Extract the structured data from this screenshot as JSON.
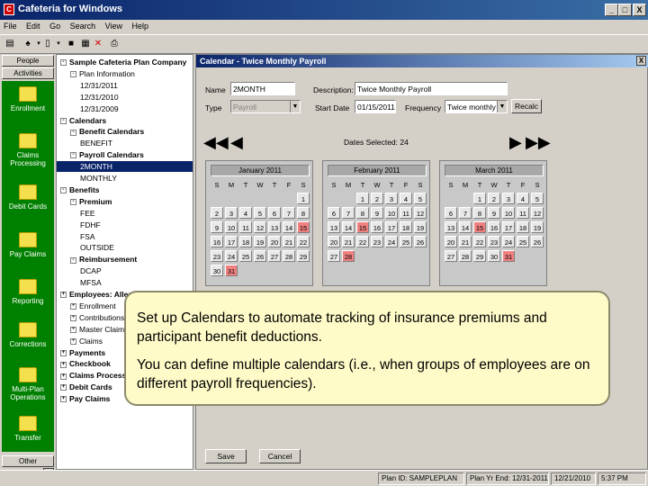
{
  "window": {
    "title": "Cafeteria for Windows",
    "app_icon": "C",
    "minimize": "_",
    "maximize": "□",
    "close": "X"
  },
  "menu": [
    "File",
    "Edit",
    "Go",
    "Search",
    "View",
    "Help"
  ],
  "left_nav": {
    "tabs": [
      "People",
      "Activities"
    ],
    "items": [
      "Enrollment",
      "Claims Processing",
      "Debit Cards",
      "Pay Claims",
      "Reporting",
      "Corrections",
      "Multi-Plan Operations",
      "Transfer"
    ],
    "bottom_tab": "Other"
  },
  "tree": [
    {
      "label": "Sample Cafeteria Plan Company",
      "indent": 0,
      "box": "-",
      "bold": true
    },
    {
      "label": "Plan Information",
      "indent": 1,
      "box": "-"
    },
    {
      "label": "12/31/2011",
      "indent": 2
    },
    {
      "label": "12/31/2010",
      "indent": 2
    },
    {
      "label": "12/31/2009",
      "indent": 2
    },
    {
      "label": "Calendars",
      "indent": 0,
      "box": "-",
      "bold": true
    },
    {
      "label": "Benefit Calendars",
      "indent": 1,
      "box": "-",
      "bold": true
    },
    {
      "label": "BENEFIT",
      "indent": 2
    },
    {
      "label": "Payroll Calendars",
      "indent": 1,
      "box": "-",
      "bold": true
    },
    {
      "label": "2MONTH",
      "indent": 2,
      "selected": true
    },
    {
      "label": "MONTHLY",
      "indent": 2
    },
    {
      "label": "Benefits",
      "indent": 0,
      "box": "-",
      "bold": true
    },
    {
      "label": "Premium",
      "indent": 1,
      "box": "-",
      "bold": true
    },
    {
      "label": "FEE",
      "indent": 2
    },
    {
      "label": "FDHF",
      "indent": 2
    },
    {
      "label": "FSA",
      "indent": 2
    },
    {
      "label": "OUTSIDE",
      "indent": 2
    },
    {
      "label": "Reimbursement",
      "indent": 1,
      "box": "-",
      "bold": true
    },
    {
      "label": "DCAP",
      "indent": 2
    },
    {
      "label": "MFSA",
      "indent": 2
    },
    {
      "label": "Employees: Allen, J",
      "indent": 0,
      "box": "+",
      "bold": true
    },
    {
      "label": "Enrollment",
      "indent": 1,
      "box": "+"
    },
    {
      "label": "Contributions",
      "indent": 1,
      "box": "+"
    },
    {
      "label": "Master Claims",
      "indent": 1,
      "box": "+"
    },
    {
      "label": "Claims",
      "indent": 1,
      "box": "+"
    },
    {
      "label": "Payments",
      "indent": 0,
      "box": "+",
      "bold": true
    },
    {
      "label": "Checkbook",
      "indent": 0,
      "box": "+",
      "bold": true
    },
    {
      "label": "Claims Processed",
      "indent": 0,
      "box": "+",
      "bold": true
    },
    {
      "label": "Debit Cards",
      "indent": 0,
      "box": "+",
      "bold": true
    },
    {
      "label": "Pay Claims",
      "indent": 0,
      "box": "+",
      "bold": true
    }
  ],
  "panel": {
    "title": "Calendar - Twice Monthly Payroll",
    "close": "X",
    "name_label": "Name",
    "name_value": "2MONTH",
    "description_label": "Description:",
    "description_value": "Twice Monthly Payroll",
    "type_label": "Type",
    "type_value": "Payroll",
    "start_date_label": "Start Date",
    "start_date_value": "01/15/2011",
    "frequency_label": "Frequency",
    "frequency_value": "Twice monthly",
    "recalc_label": "Recalc",
    "dates_selected": "Dates Selected: 24",
    "save_label": "Save",
    "cancel_label": "Cancel"
  },
  "calendars": [
    {
      "month": "January 2011",
      "start": 6,
      "days": 31,
      "highlight": [
        15,
        31
      ]
    },
    {
      "month": "February 2011",
      "start": 2,
      "days": 28,
      "highlight": [
        15,
        28
      ]
    },
    {
      "month": "March 2011",
      "start": 2,
      "days": 31,
      "highlight": [
        15,
        31
      ]
    }
  ],
  "dow": [
    "S",
    "M",
    "T",
    "W",
    "T",
    "F",
    "S"
  ],
  "status": {
    "plan_id": "Plan ID: SAMPLEPLAN",
    "plan_yr_end": "Plan Yr End: 12/31-2011",
    "date": "12/21/2010",
    "time": "5:37 PM"
  },
  "callout": {
    "line1": "Set up Calendars to automate tracking of insurance premiums and participant benefit deductions.",
    "line2": "You can define multiple calendars (i.e., when groups of employees are on different payroll frequencies)."
  }
}
